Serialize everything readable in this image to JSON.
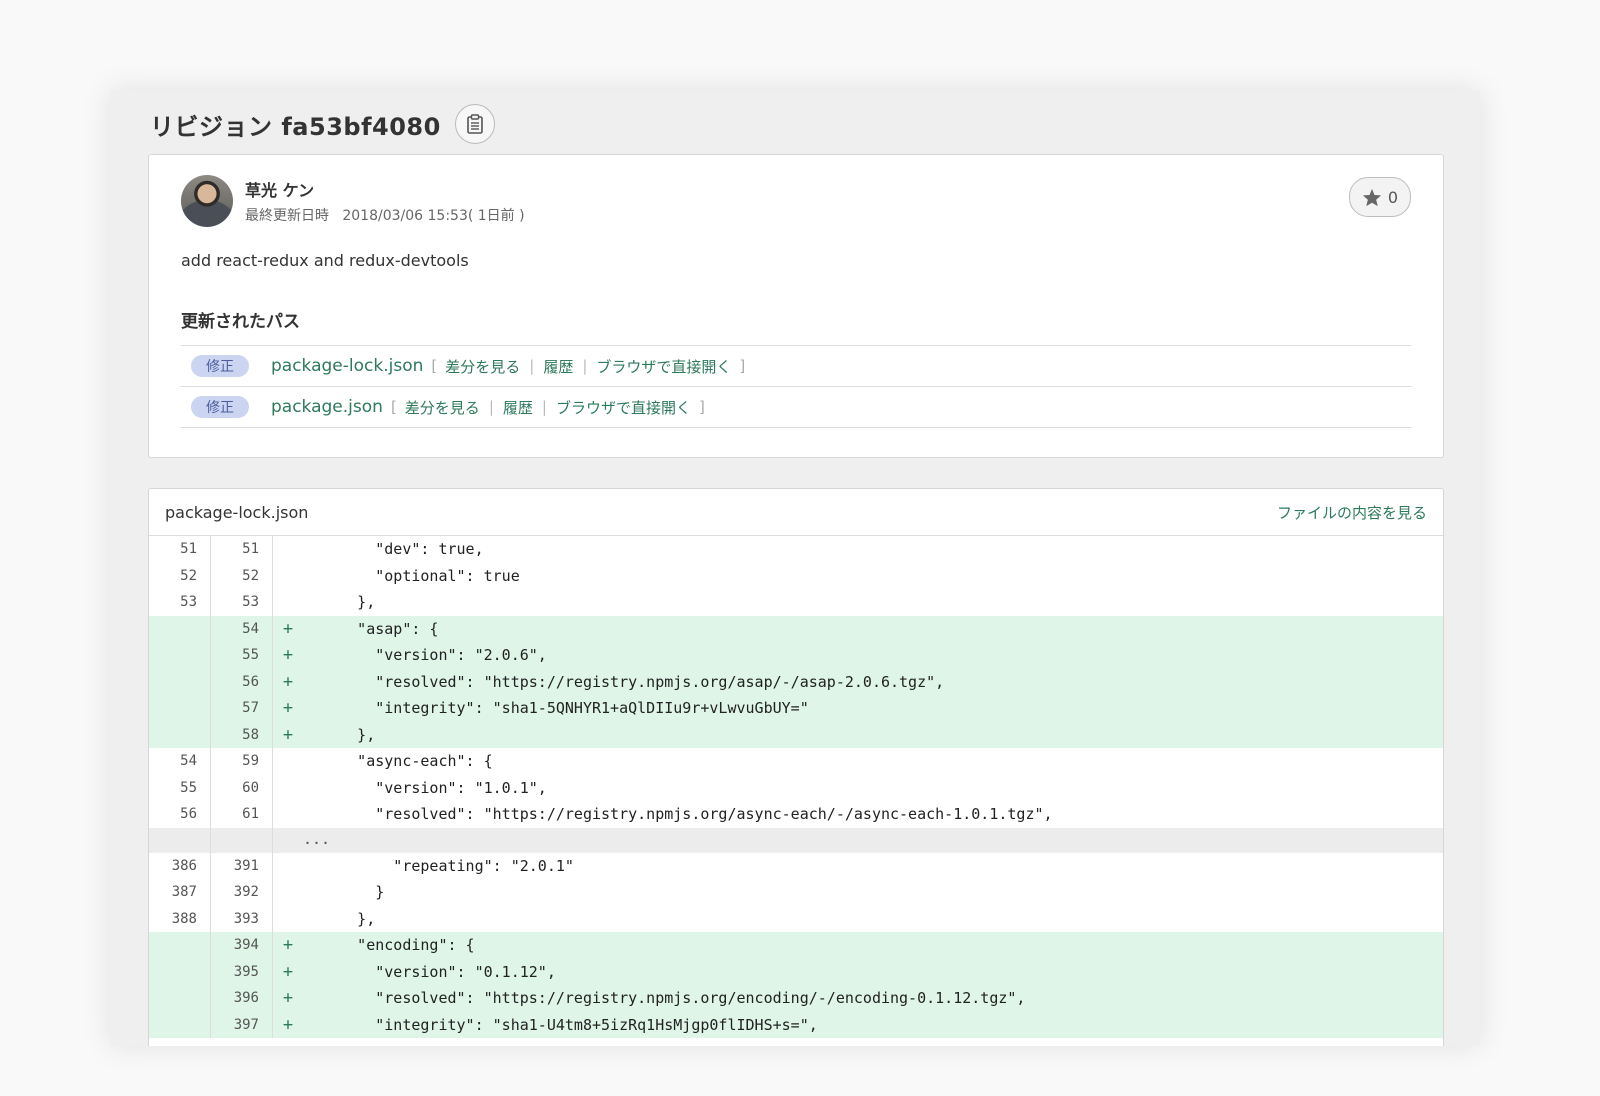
{
  "page_title": "リビジョン fa53bf4080",
  "revision": {
    "author": "草光 ケン",
    "updated_label": "最終更新日時",
    "updated_value": "2018/03/06 15:53( 1日前 )",
    "star_count": "0",
    "message": "add react-redux and redux-devtools"
  },
  "paths_heading": "更新されたパス",
  "changed_paths": [
    {
      "badge": "修正",
      "file": "package-lock.json",
      "diff": "差分を見る",
      "history": "履歴",
      "open": "ブラウザで直接開く",
      "open_bracket": "[",
      "close_bracket": "]",
      "sep": "|"
    },
    {
      "badge": "修正",
      "file": "package.json",
      "diff": "差分を見る",
      "history": "履歴",
      "open": "ブラウザで直接開く",
      "open_bracket": "[",
      "close_bracket": "]",
      "sep": "|"
    }
  ],
  "diff": {
    "filename": "package-lock.json",
    "view_file_link": "ファイルの内容を見る",
    "add_sign": "+",
    "lines": [
      {
        "old": "51",
        "new": "51",
        "type": "context",
        "text": "        \"dev\": true,"
      },
      {
        "old": "52",
        "new": "52",
        "type": "context",
        "text": "        \"optional\": true"
      },
      {
        "old": "53",
        "new": "53",
        "type": "context",
        "text": "      },"
      },
      {
        "old": "",
        "new": "54",
        "type": "added",
        "text": "      \"asap\": {"
      },
      {
        "old": "",
        "new": "55",
        "type": "added",
        "text": "        \"version\": \"2.0.6\","
      },
      {
        "old": "",
        "new": "56",
        "type": "added",
        "text": "        \"resolved\": \"https://registry.npmjs.org/asap/-/asap-2.0.6.tgz\","
      },
      {
        "old": "",
        "new": "57",
        "type": "added",
        "text": "        \"integrity\": \"sha1-5QNHYR1+aQlDIIu9r+vLwvuGbUY=\""
      },
      {
        "old": "",
        "new": "58",
        "type": "added",
        "text": "      },"
      },
      {
        "old": "54",
        "new": "59",
        "type": "context",
        "text": "      \"async-each\": {"
      },
      {
        "old": "55",
        "new": "60",
        "type": "context",
        "text": "        \"version\": \"1.0.1\","
      },
      {
        "old": "56",
        "new": "61",
        "type": "context",
        "text": "        \"resolved\": \"https://registry.npmjs.org/async-each/-/async-each-1.0.1.tgz\","
      },
      {
        "old": "",
        "new": "",
        "type": "gap",
        "text": "..."
      },
      {
        "old": "386",
        "new": "391",
        "type": "context",
        "text": "          \"repeating\": \"2.0.1\""
      },
      {
        "old": "387",
        "new": "392",
        "type": "context",
        "text": "        }"
      },
      {
        "old": "388",
        "new": "393",
        "type": "context",
        "text": "      },"
      },
      {
        "old": "",
        "new": "394",
        "type": "added",
        "text": "      \"encoding\": {"
      },
      {
        "old": "",
        "new": "395",
        "type": "added",
        "text": "        \"version\": \"0.1.12\","
      },
      {
        "old": "",
        "new": "396",
        "type": "added",
        "text": "        \"resolved\": \"https://registry.npmjs.org/encoding/-/encoding-0.1.12.tgz\","
      },
      {
        "old": "",
        "new": "397",
        "type": "added",
        "text": "        \"integrity\": \"sha1-U4tm8+5izRq1HsMjgp0flIDHS+s=\","
      }
    ]
  },
  "colors": {
    "link": "#2d7a5c",
    "added_bg": "#def5e8",
    "badge_bg": "#cbd5f1"
  },
  "icons": {
    "copy": "clipboard-icon",
    "star": "star-icon"
  }
}
